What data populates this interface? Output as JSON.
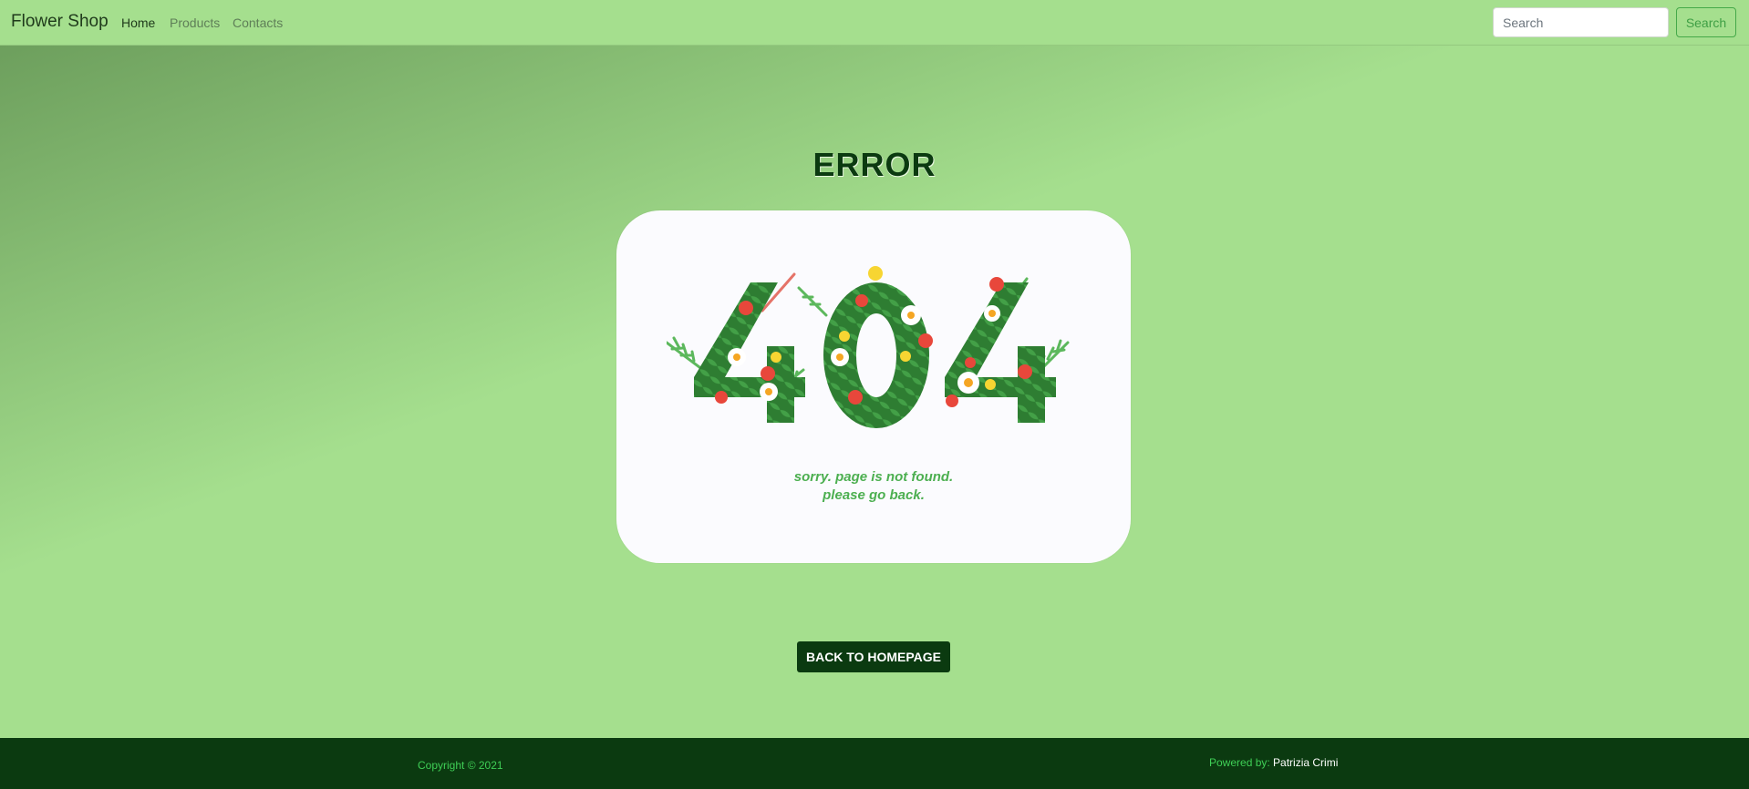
{
  "navbar": {
    "brand": "Flower Shop",
    "links": [
      {
        "label": "Home",
        "active": true
      },
      {
        "label": "Products",
        "active": false
      },
      {
        "label": "Contacts",
        "active": false
      }
    ],
    "search_placeholder": "Search",
    "search_button": "Search"
  },
  "main": {
    "title": "ERROR",
    "card": {
      "image_text": "404",
      "message_line1": "sorry. page is not found.",
      "message_line2": "please go back."
    },
    "back_button": "BACK TO HOMEPAGE"
  },
  "footer": {
    "copyright": "Copyright © 2021",
    "powered_label": "Powered by:",
    "author": "Patrizia Crimi"
  },
  "colors": {
    "page_bg": "#a5df8e",
    "dark_green": "#0b3a10",
    "footer_text": "#3fcf56",
    "digit_green": "#2e7d32"
  }
}
